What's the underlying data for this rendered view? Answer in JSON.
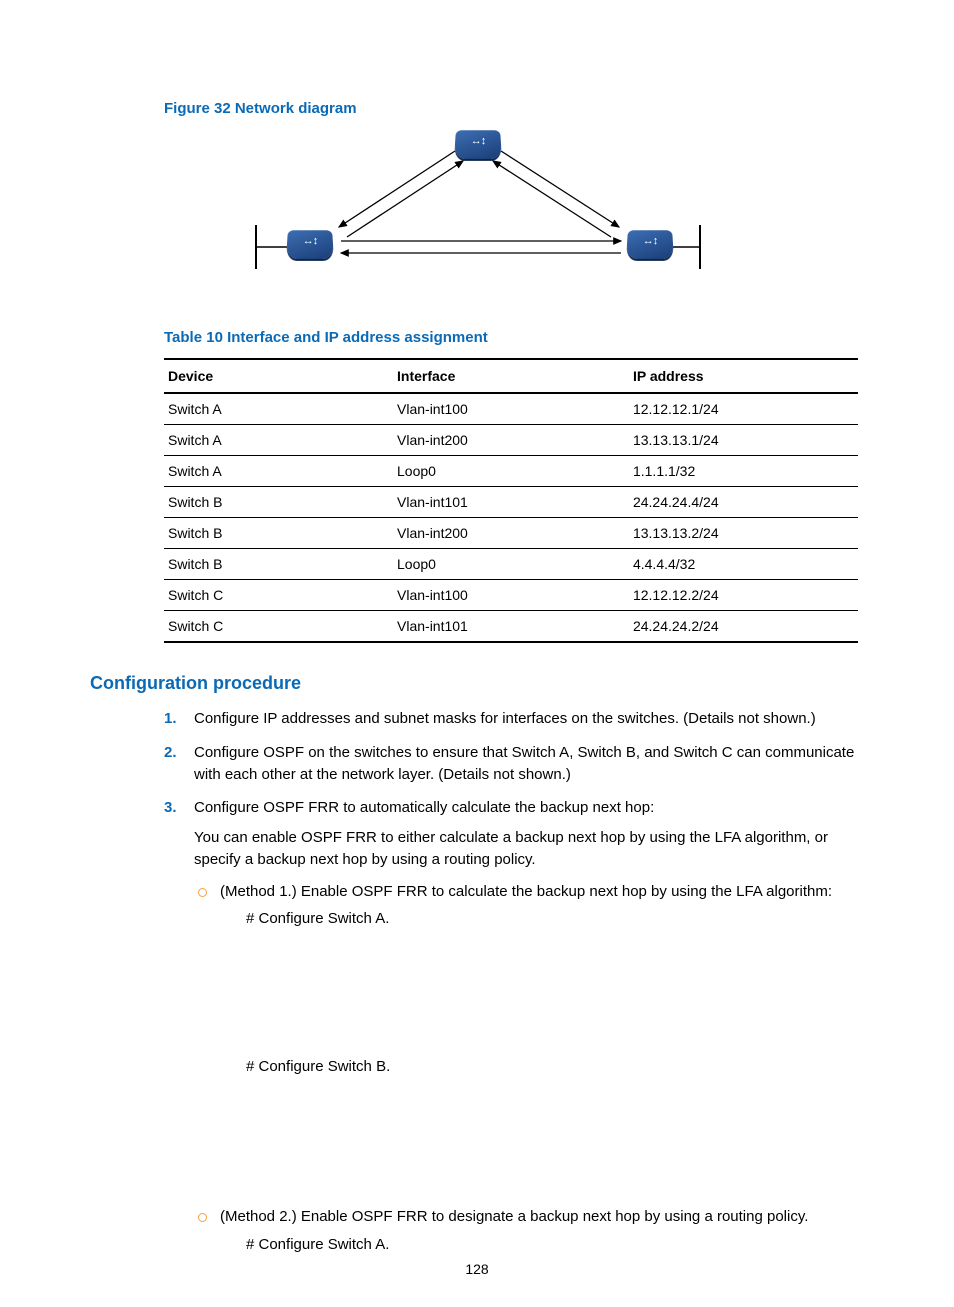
{
  "figure": {
    "caption": "Figure 32 Network diagram"
  },
  "table": {
    "caption": "Table 10 Interface and IP address assignment",
    "headers": [
      "Device",
      "Interface",
      "IP address"
    ],
    "rows": [
      {
        "device": "Switch A",
        "iface": "Vlan-int100",
        "ip": "12.12.12.1/24"
      },
      {
        "device": "Switch A",
        "iface": "Vlan-int200",
        "ip": "13.13.13.1/24"
      },
      {
        "device": "Switch A",
        "iface": "Loop0",
        "ip": "1.1.1.1/32"
      },
      {
        "device": "Switch B",
        "iface": "Vlan-int101",
        "ip": "24.24.24.4/24"
      },
      {
        "device": "Switch B",
        "iface": "Vlan-int200",
        "ip": "13.13.13.2/24"
      },
      {
        "device": "Switch B",
        "iface": "Loop0",
        "ip": "4.4.4.4/32"
      },
      {
        "device": "Switch C",
        "iface": "Vlan-int100",
        "ip": "12.12.12.2/24"
      },
      {
        "device": "Switch C",
        "iface": "Vlan-int101",
        "ip": "24.24.24.2/24"
      }
    ]
  },
  "section": {
    "heading": "Configuration procedure",
    "steps": [
      {
        "text": "Configure IP addresses and subnet masks for interfaces on the switches. (Details not shown.)"
      },
      {
        "text": "Configure OSPF on the switches to ensure that Switch A, Switch B, and Switch C can communicate with each other at the network layer. (Details not shown.)"
      },
      {
        "text": "Configure OSPF FRR to automatically calculate the backup next hop:",
        "extra": "You can enable OSPF FRR to either calculate a backup next hop by using the LFA algorithm, or specify a backup next hop by using a routing policy.",
        "subs": [
          {
            "text": "(Method 1.) Enable OSPF FRR to calculate the backup next hop by using the LFA algorithm:",
            "hashA": "# Configure Switch A.",
            "hashB": "# Configure Switch B."
          },
          {
            "text": "(Method 2.) Enable OSPF FRR to designate a backup next hop by using a routing policy.",
            "hashA": "# Configure Switch A."
          }
        ]
      }
    ]
  },
  "page_number": "128"
}
